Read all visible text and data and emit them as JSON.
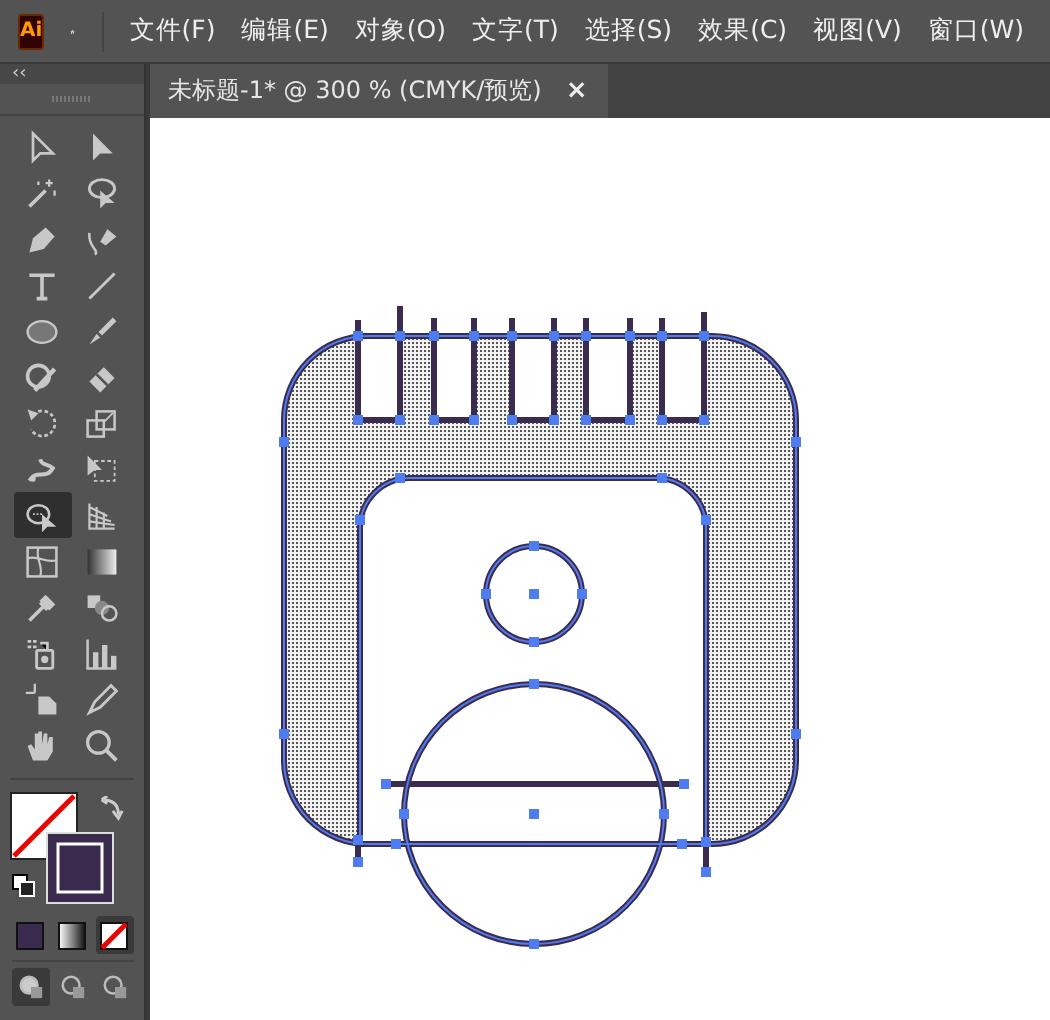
{
  "app": {
    "logo": "Ai"
  },
  "menu": [
    "文件(F)",
    "编辑(E)",
    "对象(O)",
    "文字(T)",
    "选择(S)",
    "效果(C)",
    "视图(V)",
    "窗口(W)"
  ],
  "toolbar": {
    "collapse": "‹‹",
    "tools": [
      {
        "selected": false
      },
      {
        "selected": false
      },
      {
        "selected": false
      },
      {
        "selected": false
      },
      {
        "selected": false
      },
      {
        "selected": false
      },
      {
        "selected": false
      },
      {
        "selected": false
      },
      {
        "selected": false
      },
      {
        "selected": false
      },
      {
        "selected": false
      },
      {
        "selected": false
      },
      {
        "selected": false
      },
      {
        "selected": false
      },
      {
        "selected": false
      },
      {
        "selected": false
      },
      {
        "selected": true
      },
      {
        "selected": false
      },
      {
        "selected": false
      },
      {
        "selected": false
      },
      {
        "selected": false
      },
      {
        "selected": false
      },
      {
        "selected": false
      },
      {
        "selected": false
      },
      {
        "selected": false
      },
      {
        "selected": false
      },
      {
        "selected": false
      },
      {
        "selected": false
      }
    ],
    "color_modes": [
      {
        "kind": "color",
        "selected": false
      },
      {
        "kind": "gradient",
        "selected": false
      },
      {
        "kind": "none",
        "selected": true
      }
    ],
    "draw_modes": [
      {
        "selected": true
      },
      {
        "selected": false
      },
      {
        "selected": false
      }
    ]
  },
  "document_tab": {
    "title": "未标题-1* @ 300 % (CMYK/预览)",
    "close": "×"
  }
}
